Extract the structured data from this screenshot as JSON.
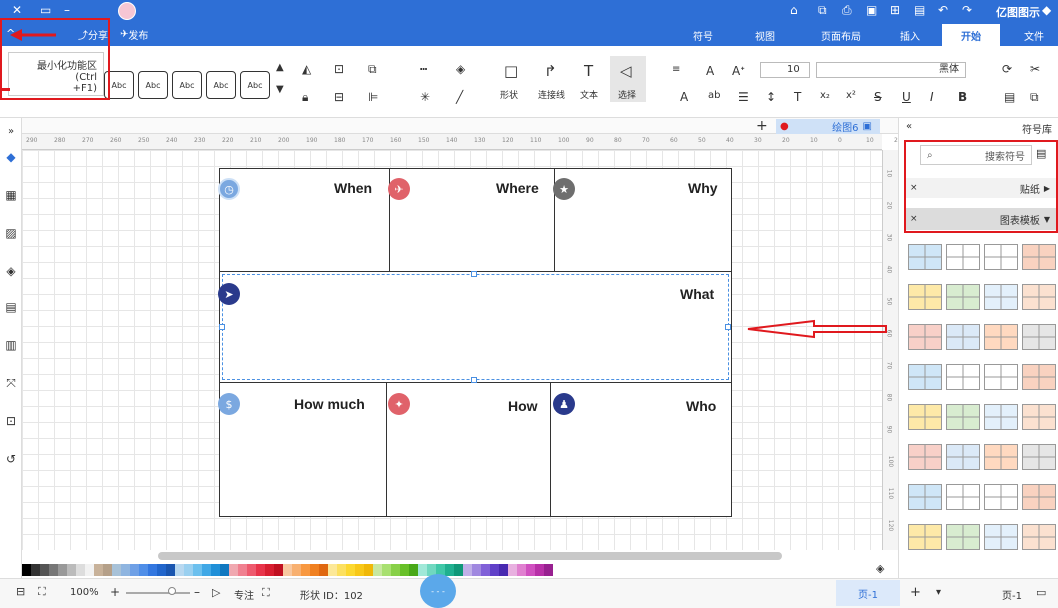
{
  "app": {
    "title": "亿图图示",
    "user_name": ""
  },
  "titlebar": {
    "collapse_label": "^",
    "share_label": "分享",
    "publish_label": "发布"
  },
  "menu": {
    "tabs": [
      "文件",
      "开始",
      "插入",
      "页面布局",
      "视图",
      "符号"
    ],
    "active": "开始"
  },
  "tooltip": {
    "line1": "最小化功能区 (Ctrl",
    "line2": "+F1)"
  },
  "ribbon": {
    "font_name": "黑体",
    "font_size": "10",
    "tools": {
      "select": "选择",
      "text": "文本",
      "connector": "连接线",
      "shape": "形状"
    },
    "abc_styles": [
      "Abc",
      "Abc",
      "Abc",
      "Abc",
      "Abc",
      "Abc"
    ]
  },
  "doc": {
    "tab_name": "绘图6",
    "add_tab_label": "+"
  },
  "ruler_ticks": [
    "290",
    "280",
    "270",
    "260",
    "250",
    "240",
    "230",
    "220",
    "210",
    "200",
    "190",
    "180",
    "170",
    "160",
    "150",
    "140",
    "130",
    "120",
    "110",
    "100",
    "90",
    "80",
    "70",
    "60",
    "50",
    "40",
    "30",
    "20",
    "10",
    "0",
    "10",
    "20"
  ],
  "vruler_ticks": [
    "10",
    "20",
    "30",
    "40",
    "50",
    "60",
    "70",
    "80",
    "90",
    "100",
    "110",
    "120"
  ],
  "diagram": {
    "cells": {
      "why": "Why",
      "where": "Where",
      "when": "When",
      "what": "What",
      "who": "Who",
      "how": "How",
      "how_much": "How much"
    }
  },
  "right_panel": {
    "title": "符号库",
    "search_placeholder": "搜索符号",
    "categories": [
      {
        "label": "贴纸",
        "expanded": false
      },
      {
        "label": "图表模板",
        "expanded": true
      }
    ]
  },
  "status": {
    "page_label": "页-1",
    "page_tab": "页-1",
    "shape_id": "形状 ID：102",
    "focus": "专注",
    "zoom": "100%"
  },
  "colors": {
    "titlebar": "#2e6fd6",
    "annotation_red": "#e0191e",
    "icon_gray": "#6e6e6e",
    "icon_red": "#e0626a",
    "icon_navy": "#2a3a8c",
    "icon_lightblue": "#7ba8e0"
  },
  "palette": [
    "#000000",
    "#333333",
    "#555555",
    "#777777",
    "#999999",
    "#bbbbbb",
    "#dddddd",
    "#f2f2f2",
    "#c8b29a",
    "#b5a089",
    "#a8c2d8",
    "#8fb5e0",
    "#6fa0e6",
    "#4f8ee8",
    "#3377e0",
    "#2266cc",
    "#1a56b0",
    "#b8d8f0",
    "#9ad0f0",
    "#6cc0ee",
    "#40a8e6",
    "#2090d8",
    "#1078c0",
    "#f0a8b0",
    "#f08090",
    "#ee5a6e",
    "#e8344a",
    "#d81e30",
    "#c01020",
    "#f8c8a0",
    "#f8b070",
    "#f89840",
    "#f08020",
    "#e06810",
    "#fce898",
    "#fce060",
    "#fcd830",
    "#f8c818",
    "#f0b808",
    "#c8e8a0",
    "#a8e070",
    "#88d048",
    "#68c028",
    "#48a818",
    "#a0e8d8",
    "#70d8c0",
    "#40c8a8",
    "#20b090",
    "#109878",
    "#c0b0e8",
    "#a088e0",
    "#8060d8",
    "#6040c8",
    "#4828b0",
    "#e8b0e0",
    "#e080d0",
    "#d050c0",
    "#b830a8",
    "#982090"
  ]
}
